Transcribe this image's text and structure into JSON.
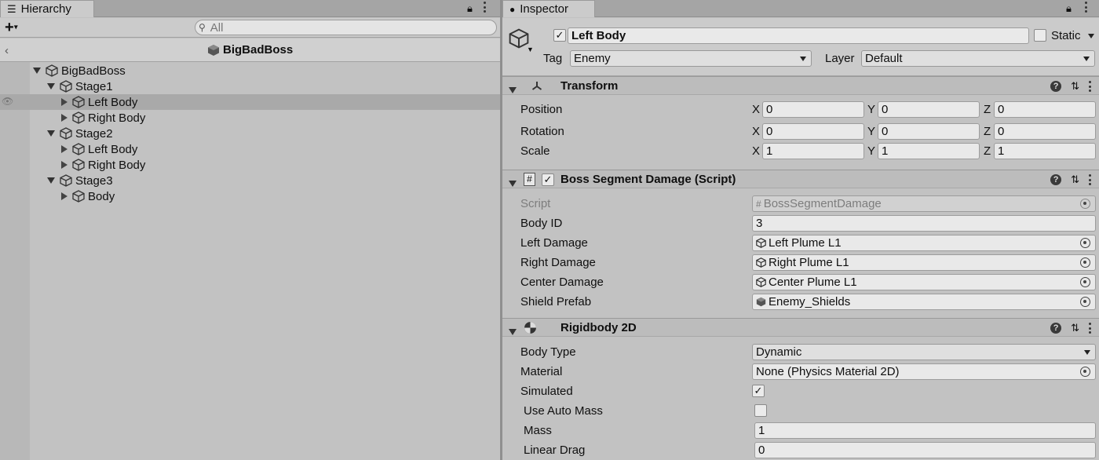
{
  "hierarchy": {
    "tab_label": "Hierarchy",
    "search_placeholder": "All",
    "scene_title": "BigBadBoss",
    "tree": [
      {
        "label": "BigBadBoss",
        "depth": 0,
        "expanded": true
      },
      {
        "label": "Stage1",
        "depth": 1,
        "expanded": true
      },
      {
        "label": "Left Body",
        "depth": 2,
        "expanded": false,
        "selected": true
      },
      {
        "label": "Right Body",
        "depth": 2,
        "expanded": false
      },
      {
        "label": "Stage2",
        "depth": 1,
        "expanded": true
      },
      {
        "label": "Left Body",
        "depth": 2,
        "expanded": false
      },
      {
        "label": "Right Body",
        "depth": 2,
        "expanded": false
      },
      {
        "label": "Stage3",
        "depth": 1,
        "expanded": true
      },
      {
        "label": "Body",
        "depth": 2,
        "expanded": false
      }
    ]
  },
  "inspector": {
    "tab_label": "Inspector",
    "object_name": "Left Body",
    "static_label": "Static",
    "tag_label": "Tag",
    "tag_value": "Enemy",
    "layer_label": "Layer",
    "layer_value": "Default",
    "transform": {
      "title": "Transform",
      "rows": [
        {
          "label": "Position",
          "x": "0",
          "y": "0",
          "z": "0"
        },
        {
          "label": "Rotation",
          "x": "0",
          "y": "0",
          "z": "0"
        },
        {
          "label": "Scale",
          "x": "1",
          "y": "1",
          "z": "1"
        }
      ],
      "axis_x": "X",
      "axis_y": "Y",
      "axis_z": "Z"
    },
    "script_component": {
      "title": "Boss Segment Damage (Script)",
      "script_label": "Script",
      "script_value": "BossSegmentDamage",
      "body_id_label": "Body ID",
      "body_id_value": "3",
      "left_damage_label": "Left Damage",
      "left_damage_value": "Left Plume L1",
      "right_damage_label": "Right Damage",
      "right_damage_value": "Right Plume L1",
      "center_damage_label": "Center Damage",
      "center_damage_value": "Center Plume L1",
      "shield_prefab_label": "Shield Prefab",
      "shield_prefab_value": "Enemy_Shields"
    },
    "rigidbody": {
      "title": "Rigidbody 2D",
      "body_type_label": "Body Type",
      "body_type_value": "Dynamic",
      "material_label": "Material",
      "material_value": "None (Physics Material 2D)",
      "simulated_label": "Simulated",
      "use_auto_mass_label": "Use Auto Mass",
      "mass_label": "Mass",
      "mass_value": "1",
      "linear_drag_label": "Linear Drag",
      "linear_drag_value": "0"
    }
  }
}
